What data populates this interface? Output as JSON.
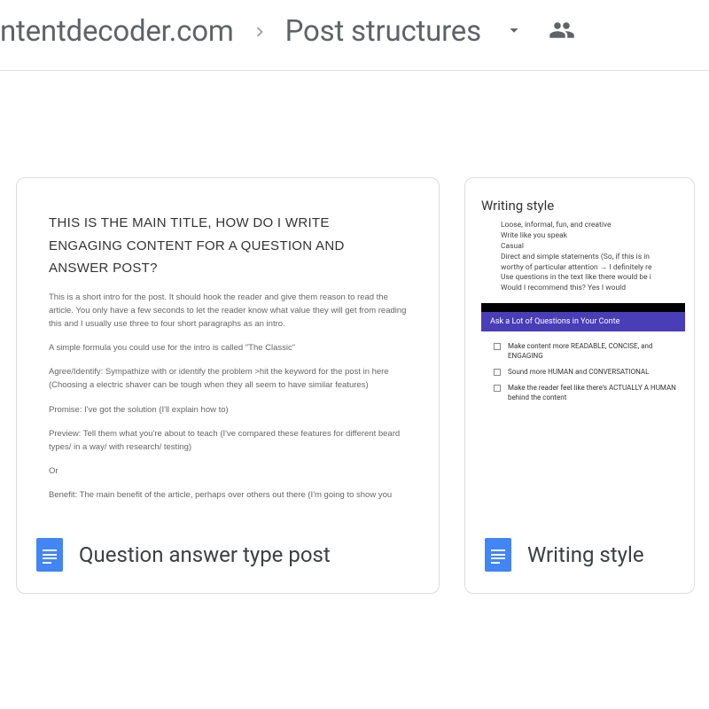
{
  "breadcrumb": {
    "item1": "ntentdecoder.com",
    "item2": "Post structures"
  },
  "cards": [
    {
      "title": "Question answer type post",
      "thumb": {
        "heading": "THIS IS THE MAIN TITLE, HOW DO I WRITE ENGAGING CONTENT FOR A QUESTION AND ANSWER POST?",
        "p1": "This is a short intro for the post. It should hook the reader and give them reason to read the article. You only have a few seconds to let the reader know what value they will get from reading this and I usually use three to four short paragraphs as an intro.",
        "p2": "A simple formula you could use for the intro is called \"The Classic\"",
        "p3": "Agree/Identify: Sympathize with or identify the problem >hit the keyword for the post in here (Choosing a electric shaver can be tough when they all seem to have similar features)",
        "p4": "Promise: I've got the solution (I'll explain how to)",
        "p5": "Preview: Tell them what you're about to teach (I've compared these features for different beard types/ in a way/ with research/ testing)",
        "p6": "Or",
        "p7": "Benefit: The main benefit of the article, perhaps over others out there (I'm going to show you"
      }
    },
    {
      "title": "Writing style",
      "thumb": {
        "heading": "Writing style",
        "bullets": [
          "Loose, informal, fun, and creative",
          "Write like you speak",
          "Casual",
          "Direct and simple statements (So, if this is in",
          "worthy of particular attention → I definitely re",
          "Use questions in the text like there would be i",
          "Would I recommend this? Yes I would"
        ],
        "purple": "Ask a Lot of Questions in Your Conte",
        "sub": [
          "Make content more READABLE, CONCISE, and ENGAGING",
          "Sound more HUMAN and CONVERSATIONAL",
          "Make the reader feel like there's ACTUALLY A HUMAN behind the content"
        ]
      }
    }
  ]
}
